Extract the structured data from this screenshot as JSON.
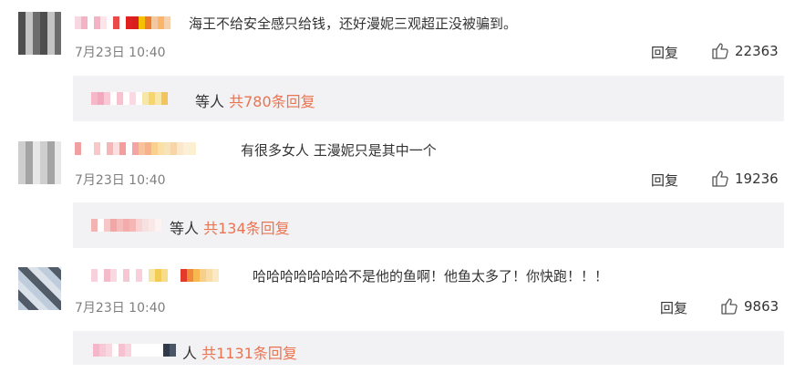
{
  "comments": [
    {
      "text": "海王不给安全感只给钱，还好漫妮三观超正没被骗到。",
      "date": "7月23日 10:40",
      "reply_label": "回复",
      "likes": "22363",
      "replies_prefix": "等人",
      "replies_count": "共780条回复"
    },
    {
      "text": "有很多女人 王漫妮只是其中一个",
      "date": "7月23日 10:40",
      "reply_label": "回复",
      "likes": "19236",
      "replies_prefix": "等人",
      "replies_count": "共134条回复"
    },
    {
      "text": "哈哈哈哈哈哈哈不是他的鱼啊！他鱼太多了！你快跑！！！",
      "date": "7月23日 10:40",
      "reply_label": "回复",
      "likes": "9863",
      "replies_prefix": "人",
      "replies_count": "共1131条回复"
    }
  ],
  "colors": {
    "accent": "#eb7350",
    "reply_box_bg": "#f2f2f5",
    "date_gray": "#7f7f7f",
    "text": "#333333"
  },
  "icons": {
    "like": "thumbs-up-icon"
  }
}
